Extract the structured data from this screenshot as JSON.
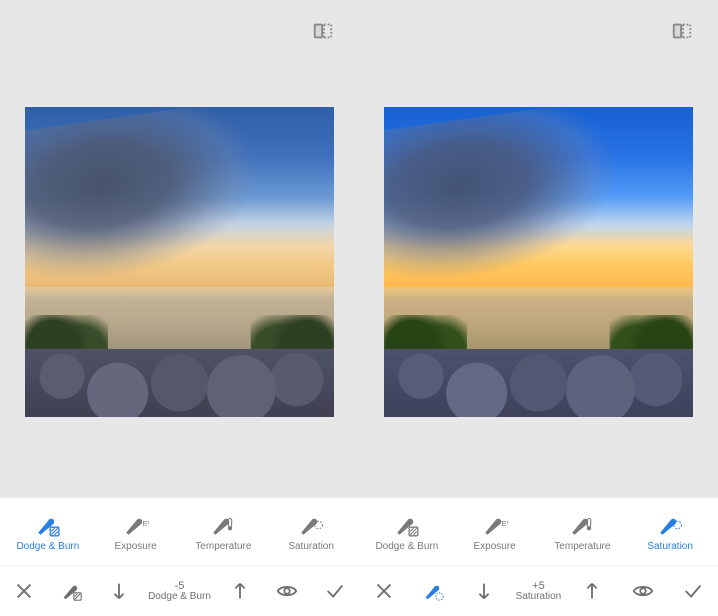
{
  "panels": [
    {
      "tools": [
        {
          "label": "Dodge & Burn",
          "active": true
        },
        {
          "label": "Exposure",
          "active": false
        },
        {
          "label": "Temperature",
          "active": false
        },
        {
          "label": "Saturation",
          "active": false
        }
      ],
      "brush_active": false,
      "adjust": {
        "value": "-5",
        "label": "Dodge & Burn"
      },
      "photo_variant": "normal"
    },
    {
      "tools": [
        {
          "label": "Dodge & Burn",
          "active": false
        },
        {
          "label": "Exposure",
          "active": false
        },
        {
          "label": "Temperature",
          "active": false
        },
        {
          "label": "Saturation",
          "active": true
        }
      ],
      "brush_active": true,
      "adjust": {
        "value": "+5",
        "label": "Saturation"
      },
      "photo_variant": "saturated"
    }
  ],
  "colors": {
    "accent": "#2a7de1",
    "dim": "#7a7a7a"
  }
}
